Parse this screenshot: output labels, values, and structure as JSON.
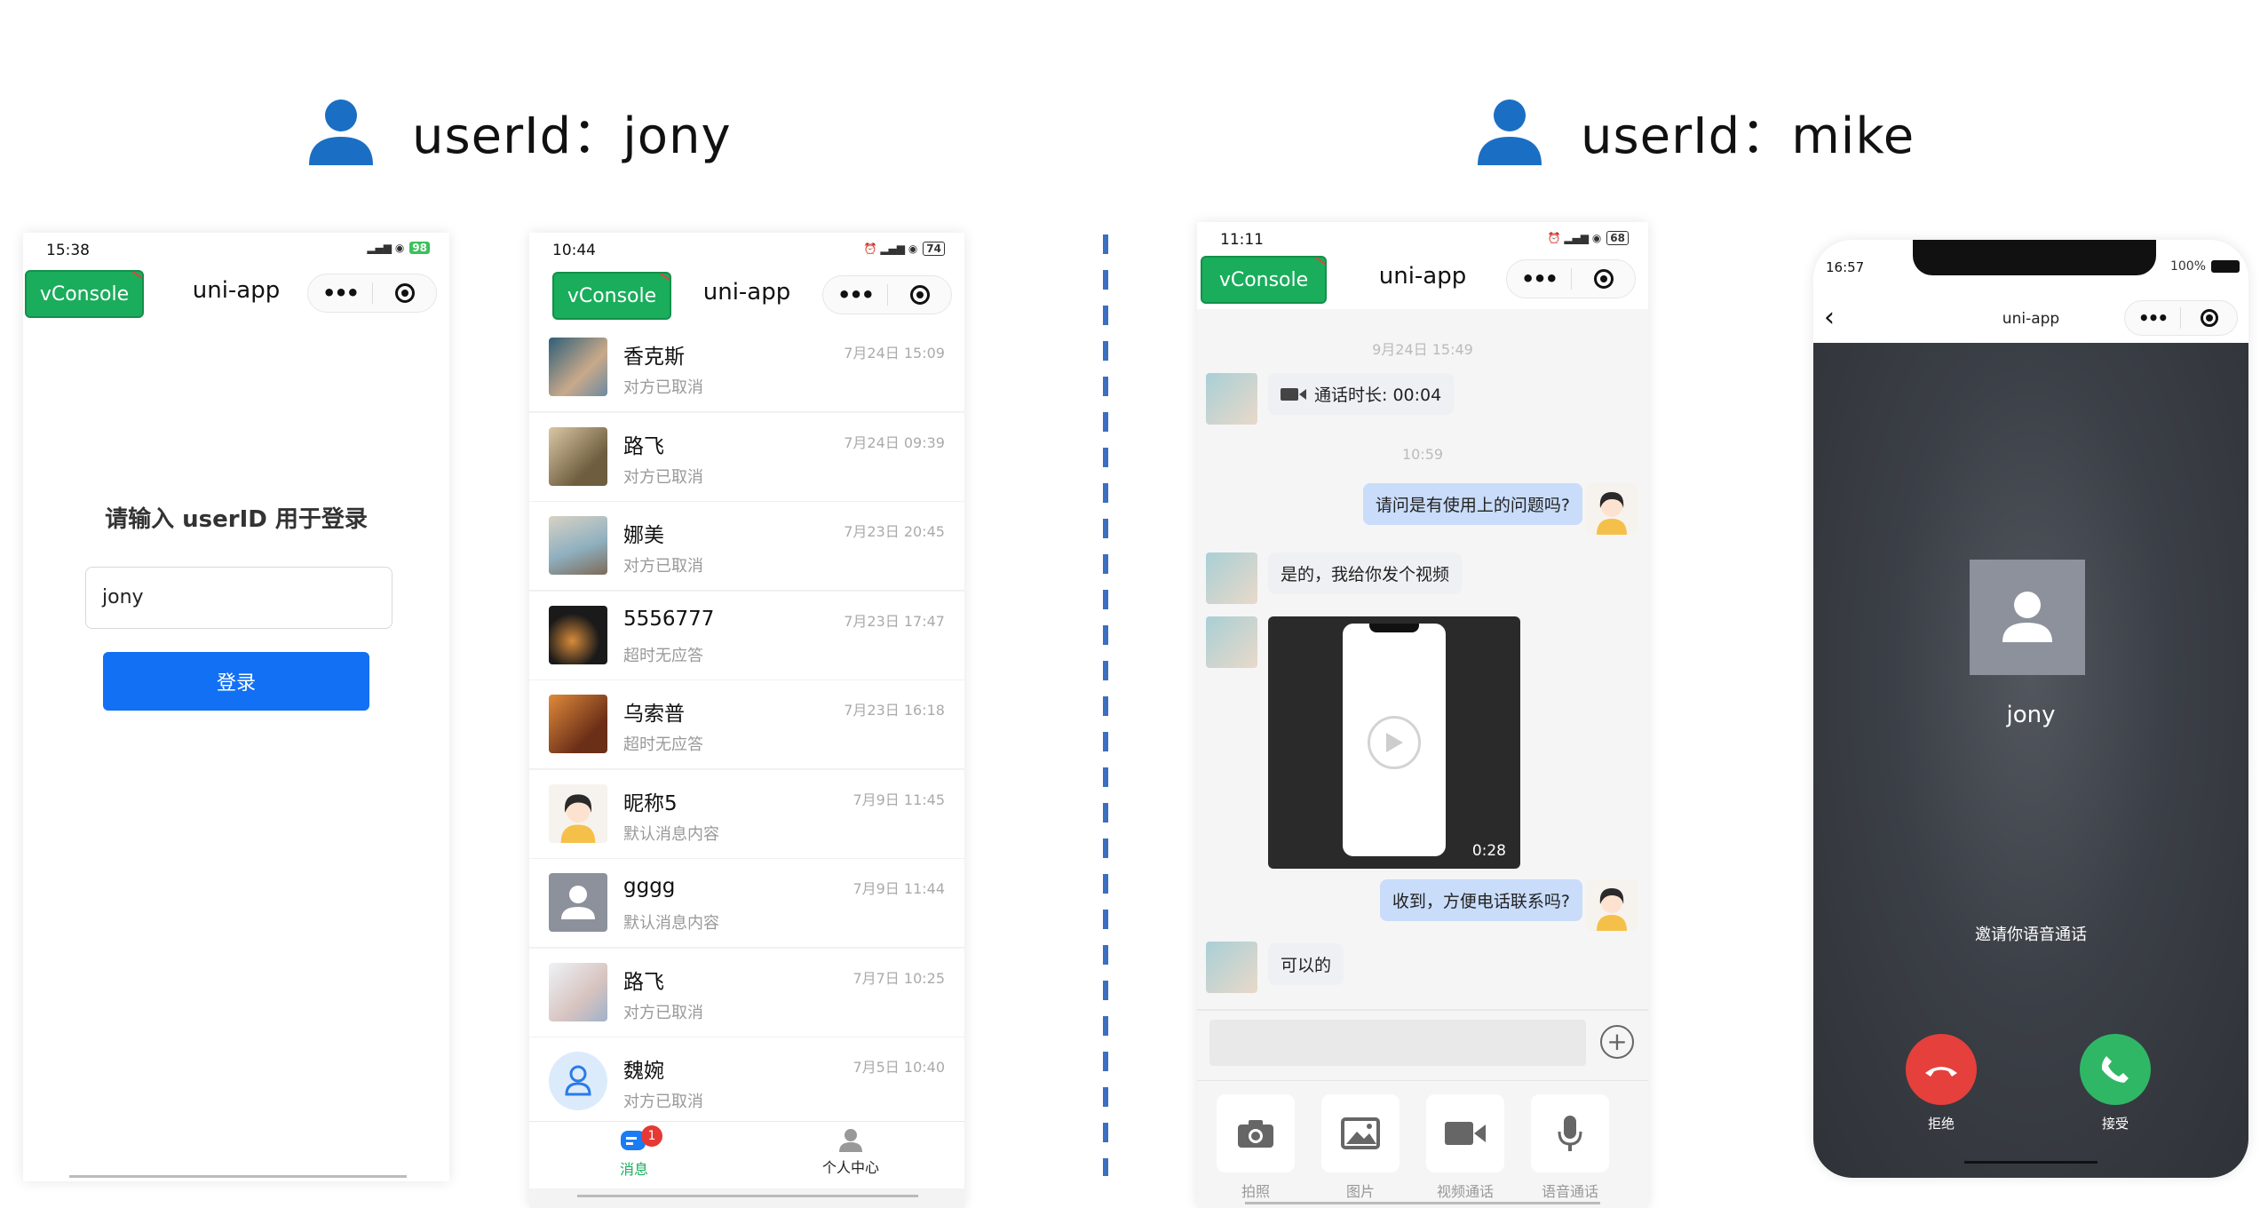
{
  "headers": {
    "left": "userId：jony",
    "right": "userId：mike"
  },
  "colors": {
    "accent_blue": "#1270f5",
    "vconsole_green": "#1aad5c",
    "decline_red": "#e5403c",
    "accept_green": "#2fb765",
    "divider_blue": "#3a6fc2",
    "user_icon_blue": "#1a6fc4"
  },
  "phone1": {
    "status": {
      "time": "15:38",
      "battery": "98"
    },
    "vconsole": "vConsole",
    "nav_title": "uni-app",
    "login_title": "请输入 userID 用于登录",
    "input_value": "jony",
    "login_button": "登录"
  },
  "phone2": {
    "status": {
      "time": "10:44",
      "battery": "74"
    },
    "vconsole": "vConsole",
    "nav_title": "uni-app",
    "conversations": [
      {
        "name": "香克斯",
        "message": "对方已取消",
        "time": "7月24日 15:09",
        "avatar": "photo-girl-hat"
      },
      {
        "name": "路飞",
        "message": "对方已取消",
        "time": "7月24日 09:39",
        "avatar": "photo-girl-hair"
      },
      {
        "name": "娜美",
        "message": "对方已取消",
        "time": "7月23日 20:45",
        "avatar": "photo-beach"
      },
      {
        "name": "5556777",
        "message": "超时无应答",
        "time": "7月23日 17:47",
        "avatar": "photo-dark"
      },
      {
        "name": "乌索普",
        "message": "超时无应答",
        "time": "7月23日 16:18",
        "avatar": "photo-orange"
      },
      {
        "name": "昵称5",
        "message": "默认消息内容",
        "time": "7月9日 11:45",
        "avatar": "cartoon-girl"
      },
      {
        "name": "gggg",
        "message": "默认消息内容",
        "time": "7月9日 11:44",
        "avatar": "default-gray"
      },
      {
        "name": "路飞",
        "message": "对方已取消",
        "time": "7月7日 10:25",
        "avatar": "photo-girl-light"
      },
      {
        "name": "魏婉",
        "message": "对方已取消",
        "time": "7月5日 10:40",
        "avatar": "default-blue"
      }
    ],
    "tabs": {
      "messages": "消息",
      "profile": "个人中心",
      "badge": "1"
    }
  },
  "phone3": {
    "status": {
      "time": "11:11",
      "battery": "68"
    },
    "vconsole": "vConsole",
    "nav_title": "uni-app",
    "timestamp1": "9月24日 15:49",
    "call_duration": "通话时长: 00:04",
    "timestamp2": "10:59",
    "messages": [
      {
        "from": "me",
        "text": "请问是有使用上的问题吗?"
      },
      {
        "from": "other",
        "text": "是的，我给你发个视频"
      },
      {
        "from": "me",
        "text": "收到，方便电话联系吗?"
      },
      {
        "from": "other",
        "text": "可以的"
      }
    ],
    "video_duration": "0:28",
    "tools": [
      {
        "label": "拍照",
        "icon": "camera-icon"
      },
      {
        "label": "图片",
        "icon": "image-icon"
      },
      {
        "label": "视频通话",
        "icon": "video-icon"
      },
      {
        "label": "语音通话",
        "icon": "mic-icon"
      }
    ]
  },
  "phone4": {
    "status": {
      "time": "16:57",
      "battery": "100%"
    },
    "nav_title": "uni-app",
    "caller_name": "jony",
    "invite_text": "邀请你语音通话",
    "decline_label": "拒绝",
    "accept_label": "接受"
  }
}
